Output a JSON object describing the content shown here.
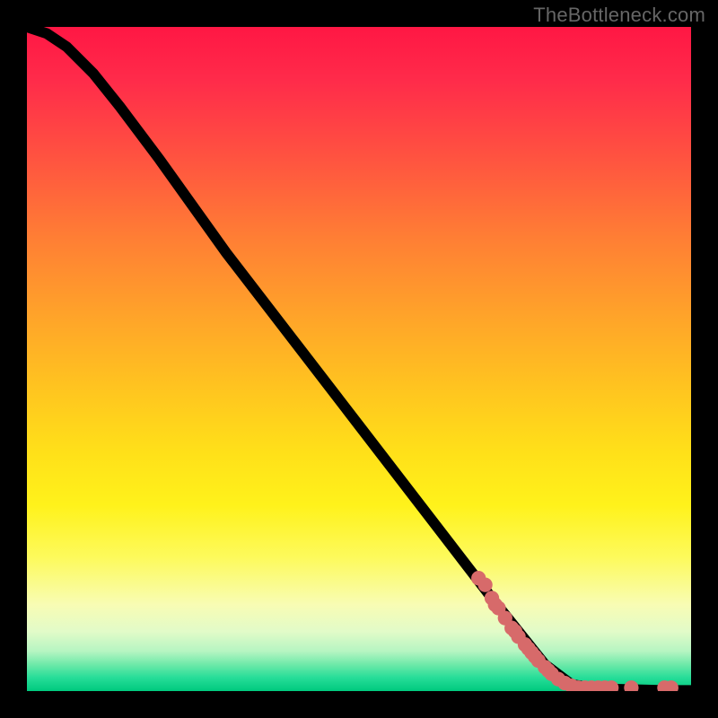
{
  "watermark": "TheBottleneck.com",
  "chart_data": {
    "type": "line",
    "title": "",
    "xlabel": "",
    "ylabel": "",
    "xlim": [
      0,
      100
    ],
    "ylim": [
      0,
      100
    ],
    "series": [
      {
        "name": "curve",
        "x": [
          0,
          3,
          6,
          10,
          14,
          20,
          30,
          40,
          50,
          60,
          70,
          78,
          82,
          85,
          88,
          92,
          96,
          100
        ],
        "y": [
          100,
          99,
          97,
          93,
          88,
          80,
          66,
          53,
          40,
          27,
          14,
          4,
          1,
          0.5,
          0.3,
          0.2,
          0.1,
          0.1
        ]
      }
    ],
    "points": [
      {
        "x": 68,
        "y": 17
      },
      {
        "x": 69,
        "y": 16
      },
      {
        "x": 70,
        "y": 14
      },
      {
        "x": 70.5,
        "y": 13
      },
      {
        "x": 71,
        "y": 12.5
      },
      {
        "x": 72,
        "y": 11
      },
      {
        "x": 73,
        "y": 9.5
      },
      {
        "x": 73.5,
        "y": 9
      },
      {
        "x": 74,
        "y": 8.2
      },
      {
        "x": 75,
        "y": 7
      },
      {
        "x": 75.5,
        "y": 6.4
      },
      {
        "x": 76,
        "y": 5.8
      },
      {
        "x": 76.5,
        "y": 5.2
      },
      {
        "x": 77,
        "y": 4.6
      },
      {
        "x": 78,
        "y": 3.6
      },
      {
        "x": 78.5,
        "y": 3.1
      },
      {
        "x": 79,
        "y": 2.6
      },
      {
        "x": 80,
        "y": 1.8
      },
      {
        "x": 81,
        "y": 1.2
      },
      {
        "x": 82,
        "y": 0.8
      },
      {
        "x": 83,
        "y": 0.5
      },
      {
        "x": 84,
        "y": 0.5
      },
      {
        "x": 85,
        "y": 0.5
      },
      {
        "x": 86,
        "y": 0.5
      },
      {
        "x": 87,
        "y": 0.5
      },
      {
        "x": 88,
        "y": 0.5
      },
      {
        "x": 91,
        "y": 0.5
      },
      {
        "x": 96,
        "y": 0.5
      },
      {
        "x": 97,
        "y": 0.5
      }
    ]
  }
}
